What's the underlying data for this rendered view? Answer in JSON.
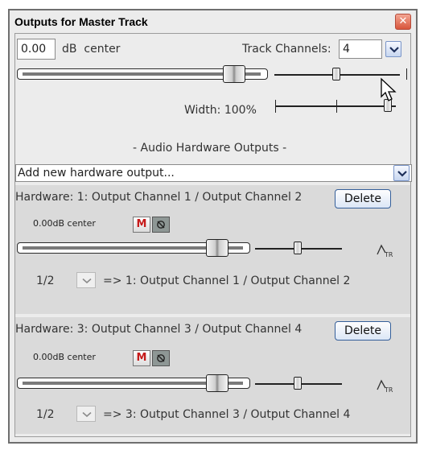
{
  "window": {
    "title": "Outputs for Master Track"
  },
  "master": {
    "volume_value": "0.00",
    "volume_unit_pan": "dB  center",
    "track_channels_label": "Track Channels:",
    "track_channels_value": "4",
    "width_label": "Width: 100%"
  },
  "audio_hw": {
    "section_label": "- Audio Hardware Outputs -",
    "add_output_placeholder": "Add new hardware output..."
  },
  "outputs": [
    {
      "title": "Hardware: 1: Output Channel 1 / Output Channel 2",
      "delete_label": "Delete",
      "vol_pan": "0.00dB center",
      "mute_label": "M",
      "channel_select": "1/2",
      "route_text": "=> 1: Output Channel 1 / Output Channel 2"
    },
    {
      "title": "Hardware: 3: Output Channel 3 / Output Channel 4",
      "delete_label": "Delete",
      "vol_pan": "0.00dB center",
      "mute_label": "M",
      "channel_select": "1/2",
      "route_text": "=> 3: Output Channel 3 / Output Channel 4"
    }
  ],
  "icons": {
    "close": "close-icon",
    "dropdown": "chevron-down-icon",
    "phase": "phase-invert-icon",
    "envelope": "envelope-tr-icon",
    "cursor": "mouse-pointer-icon"
  },
  "colors": {
    "accent": "#7a95c8",
    "mute_red": "#c61b1b",
    "close_red": "#d8553b"
  }
}
